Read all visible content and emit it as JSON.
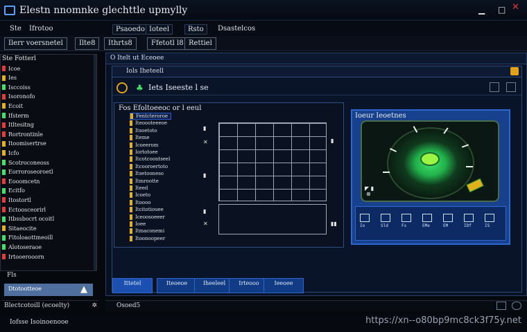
{
  "window": {
    "title": "Elestn nnomnke glechttle upmylly",
    "icons": [
      "app-icon",
      "minimize-icon",
      "maximize-icon",
      "close-icon"
    ],
    "colors": {
      "accent": "#2f67d1",
      "close": "#e23b3b",
      "highlight": "#e3b21b",
      "radar": "#3fe36b"
    }
  },
  "menubar": {
    "items": [
      "Ste",
      "Ifrotoo",
      "Psaoedo",
      "Ioteel",
      "Rsto",
      "Dsastelcos"
    ]
  },
  "toolbar": {
    "buttons": [
      "Ilerr voersnetel",
      "Ilte8",
      "Ithrts8",
      "Ffetotl l8",
      "Rettiel"
    ]
  },
  "sidebar": {
    "header": "Ste Fotterl",
    "items": [
      {
        "label": "Icoe",
        "color": "#e23b3b"
      },
      {
        "label": "Ies",
        "color": "#e3b21b"
      },
      {
        "label": "Isccoiss",
        "color": "#3fe36b"
      },
      {
        "label": "Isoronofo",
        "color": "#e23b3b"
      },
      {
        "label": "Ecoit",
        "color": "#e3b21b"
      },
      {
        "label": "Ifsterm",
        "color": "#3fe36b"
      },
      {
        "label": "Itltesitng",
        "color": "#e23b3b"
      },
      {
        "label": "Rortrontinle",
        "color": "#e23b3b"
      },
      {
        "label": "Itoomisertrse",
        "color": "#e3b21b"
      },
      {
        "label": "Icfo",
        "color": "#e3b21b"
      },
      {
        "label": "Scotroconeoss",
        "color": "#3fe36b"
      },
      {
        "label": "Eorroroseoroetl",
        "color": "#3fe36b"
      },
      {
        "label": "Eooomcetn",
        "color": "#e23b3b"
      },
      {
        "label": "Ecitfo",
        "color": "#3fe36b"
      },
      {
        "label": "Itostortl",
        "color": "#e23b3b"
      },
      {
        "label": "Ectoosceorirl",
        "color": "#e23b3b"
      },
      {
        "label": "Itbssbocrt ocoitl",
        "color": "#3fe36b"
      },
      {
        "label": "Sitaeocite",
        "color": "#e3b21b"
      },
      {
        "label": "Fitoloaottmeoill",
        "color": "#3fe36b"
      },
      {
        "label": "Alotoseraoe",
        "color": "#3fe36b"
      },
      {
        "label": "Irtooerooorn",
        "color": "#e23b3b"
      }
    ],
    "bottom_label": "Fls",
    "action_label": "Dtotootteoe"
  },
  "main": {
    "header": "O Itelt ut Eceoee",
    "inner_title": "Iols Iheteell",
    "sub_title": "Iets  Iseeste l se",
    "left_panel": {
      "title": "Fos Efoltoeeoc or l eeul",
      "list": [
        "Fentcteroroe",
        "Iteoooteeeoe",
        "Itsoetoto",
        "Iteme",
        "Icoeerom",
        "Iortotoee",
        "Itcotcoontseel",
        "Itcooroertoto",
        "Itsetooneso",
        "Itmrootte",
        "Iteed",
        "Icoeto",
        "Itoooo",
        "Itcitotiouee",
        "Iceoosoeeer",
        "Ioee",
        "Itmaconemi",
        "Itoonoopeer"
      ]
    },
    "right_panel": {
      "title": "Ioeur Ieoetnes",
      "meters": [
        "Io",
        "Sld",
        "Fs",
        "EMe",
        "EM",
        "IDf",
        "IS"
      ]
    },
    "tabs": [
      "Ittetel",
      "Iteoeoe",
      "Iheeleel",
      "Irteooo",
      "Ieeoee"
    ]
  },
  "status": {
    "left": "Blectcotoill (ecoelty)",
    "right": "Osoed5"
  },
  "taskbar": {
    "label": "Iofsse Isoinoenooe",
    "watermark": "https://xn--o80bp9mc8ck3f75y.net"
  }
}
